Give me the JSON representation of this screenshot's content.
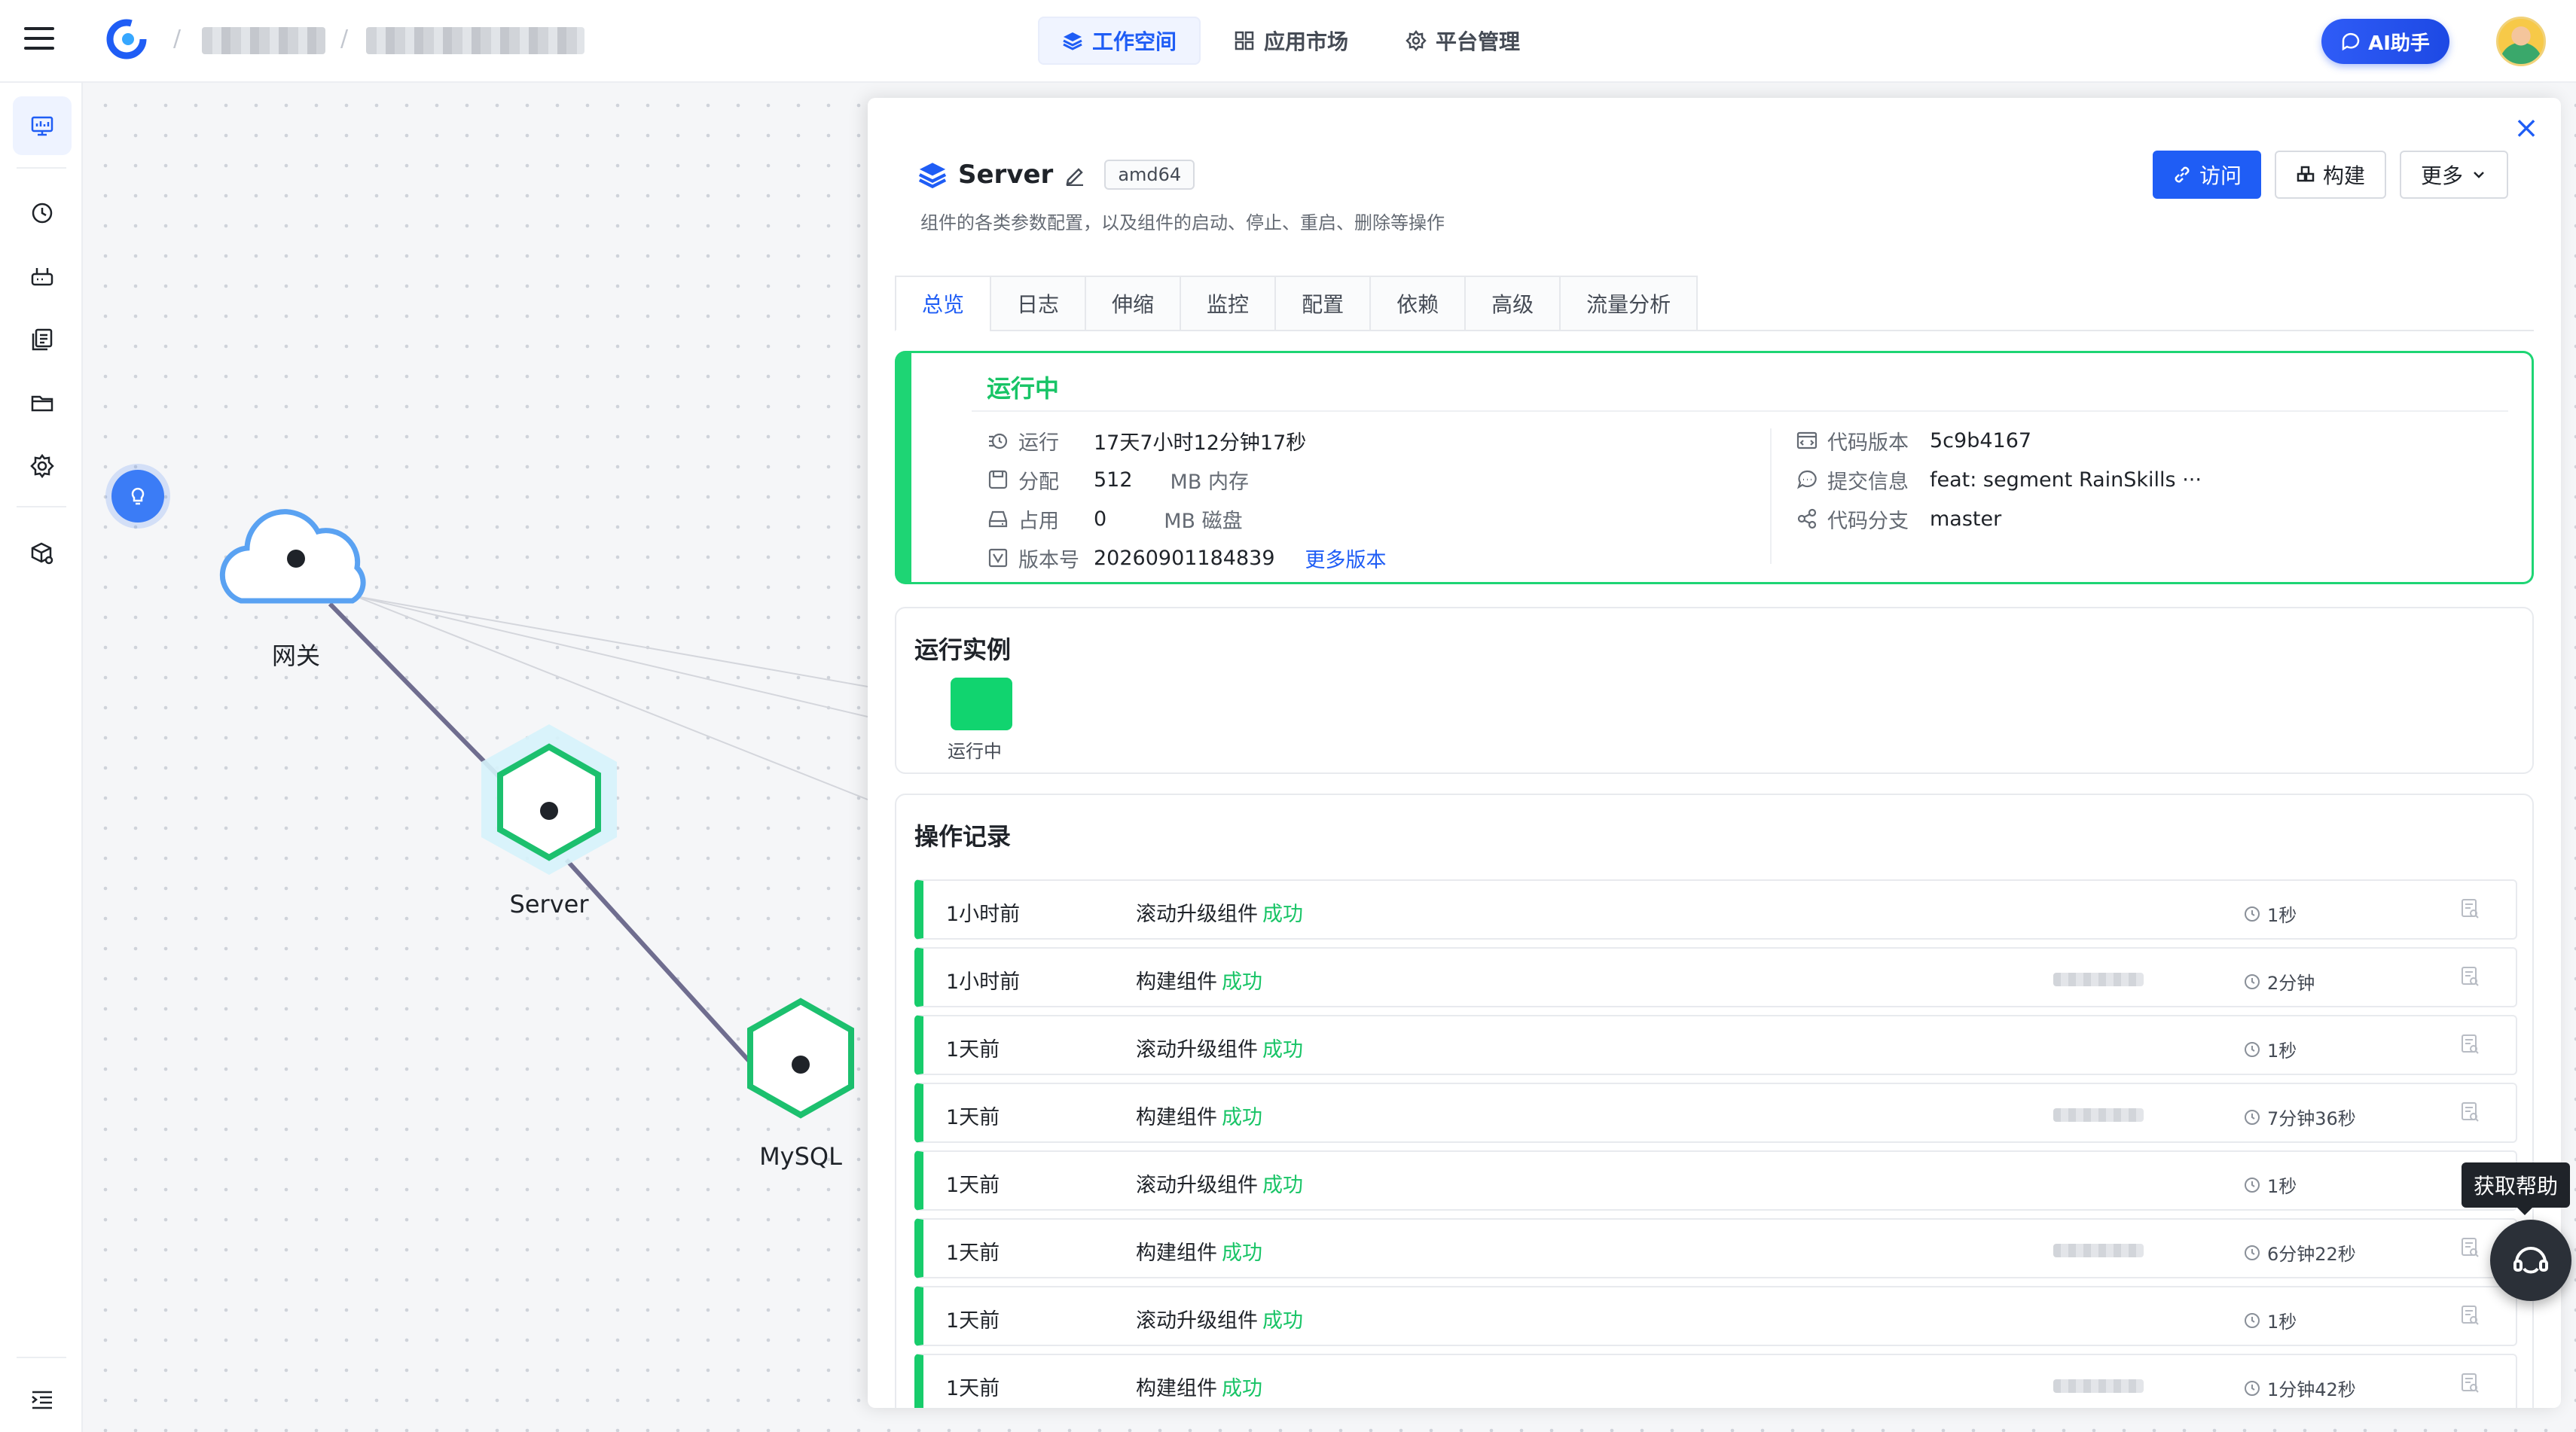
{
  "topbar": {
    "nav": [
      {
        "label": "工作空间",
        "icon": "layers-icon",
        "active": true
      },
      {
        "label": "应用市场",
        "icon": "grid-icon",
        "active": false
      },
      {
        "label": "平台管理",
        "icon": "gear-icon",
        "active": false
      }
    ],
    "ai_label": "AI助手",
    "accent": "#1f5df5"
  },
  "topology": {
    "nodes": [
      {
        "label": "网关",
        "icon": "cloud-icon"
      },
      {
        "label": "Server",
        "icon": "hexagon-icon"
      },
      {
        "label": "MySQL",
        "icon": "hexagon-icon"
      }
    ]
  },
  "drawer": {
    "component_name": "Server",
    "arch": "amd64",
    "description": "组件的各类参数配置，以及组件的启动、停止、重启、删除等操作",
    "actions": {
      "visit": "访问",
      "build": "构建",
      "more": "更多"
    },
    "tabs": [
      "总览",
      "日志",
      "伸缩",
      "监控",
      "配置",
      "依赖",
      "高级",
      "流量分析"
    ],
    "status": {
      "title": "运行中",
      "run_label": "运行",
      "run_value": "17天7小时12分钟17秒",
      "alloc_label": "分配",
      "alloc_value": "512",
      "alloc_unit": "MB 内存",
      "used_label": "占用",
      "used_value": "0",
      "used_unit": "MB 磁盘",
      "version_label": "版本号",
      "version_value": "20260901184839",
      "more_versions": "更多版本",
      "code_version_label": "代码版本",
      "code_version_value": "5c9b4167",
      "commit_label": "提交信息",
      "commit_value": "feat: segment RainSkills ···",
      "branch_label": "代码分支",
      "branch_value": "master"
    },
    "instances": {
      "title": "运行实例",
      "items": [
        {
          "label": "运行中",
          "color": "#11d46f"
        }
      ]
    },
    "records": {
      "title": "操作记录",
      "success_label": "成功",
      "rows": [
        {
          "time": "1小时前",
          "action": "滚动升级组件",
          "duration": "1秒",
          "has_user": false
        },
        {
          "time": "1小时前",
          "action": "构建组件",
          "duration": "2分钟",
          "has_user": true
        },
        {
          "time": "1天前",
          "action": "滚动升级组件",
          "duration": "1秒",
          "has_user": false
        },
        {
          "time": "1天前",
          "action": "构建组件",
          "duration": "7分钟36秒",
          "has_user": true
        },
        {
          "time": "1天前",
          "action": "滚动升级组件",
          "duration": "1秒",
          "has_user": false
        },
        {
          "time": "1天前",
          "action": "构建组件",
          "duration": "6分钟22秒",
          "has_user": true
        },
        {
          "time": "1天前",
          "action": "滚动升级组件",
          "duration": "1秒",
          "has_user": false
        },
        {
          "time": "1天前",
          "action": "构建组件",
          "duration": "1分钟42秒",
          "has_user": true
        }
      ]
    }
  },
  "help": {
    "tooltip": "获取帮助"
  }
}
